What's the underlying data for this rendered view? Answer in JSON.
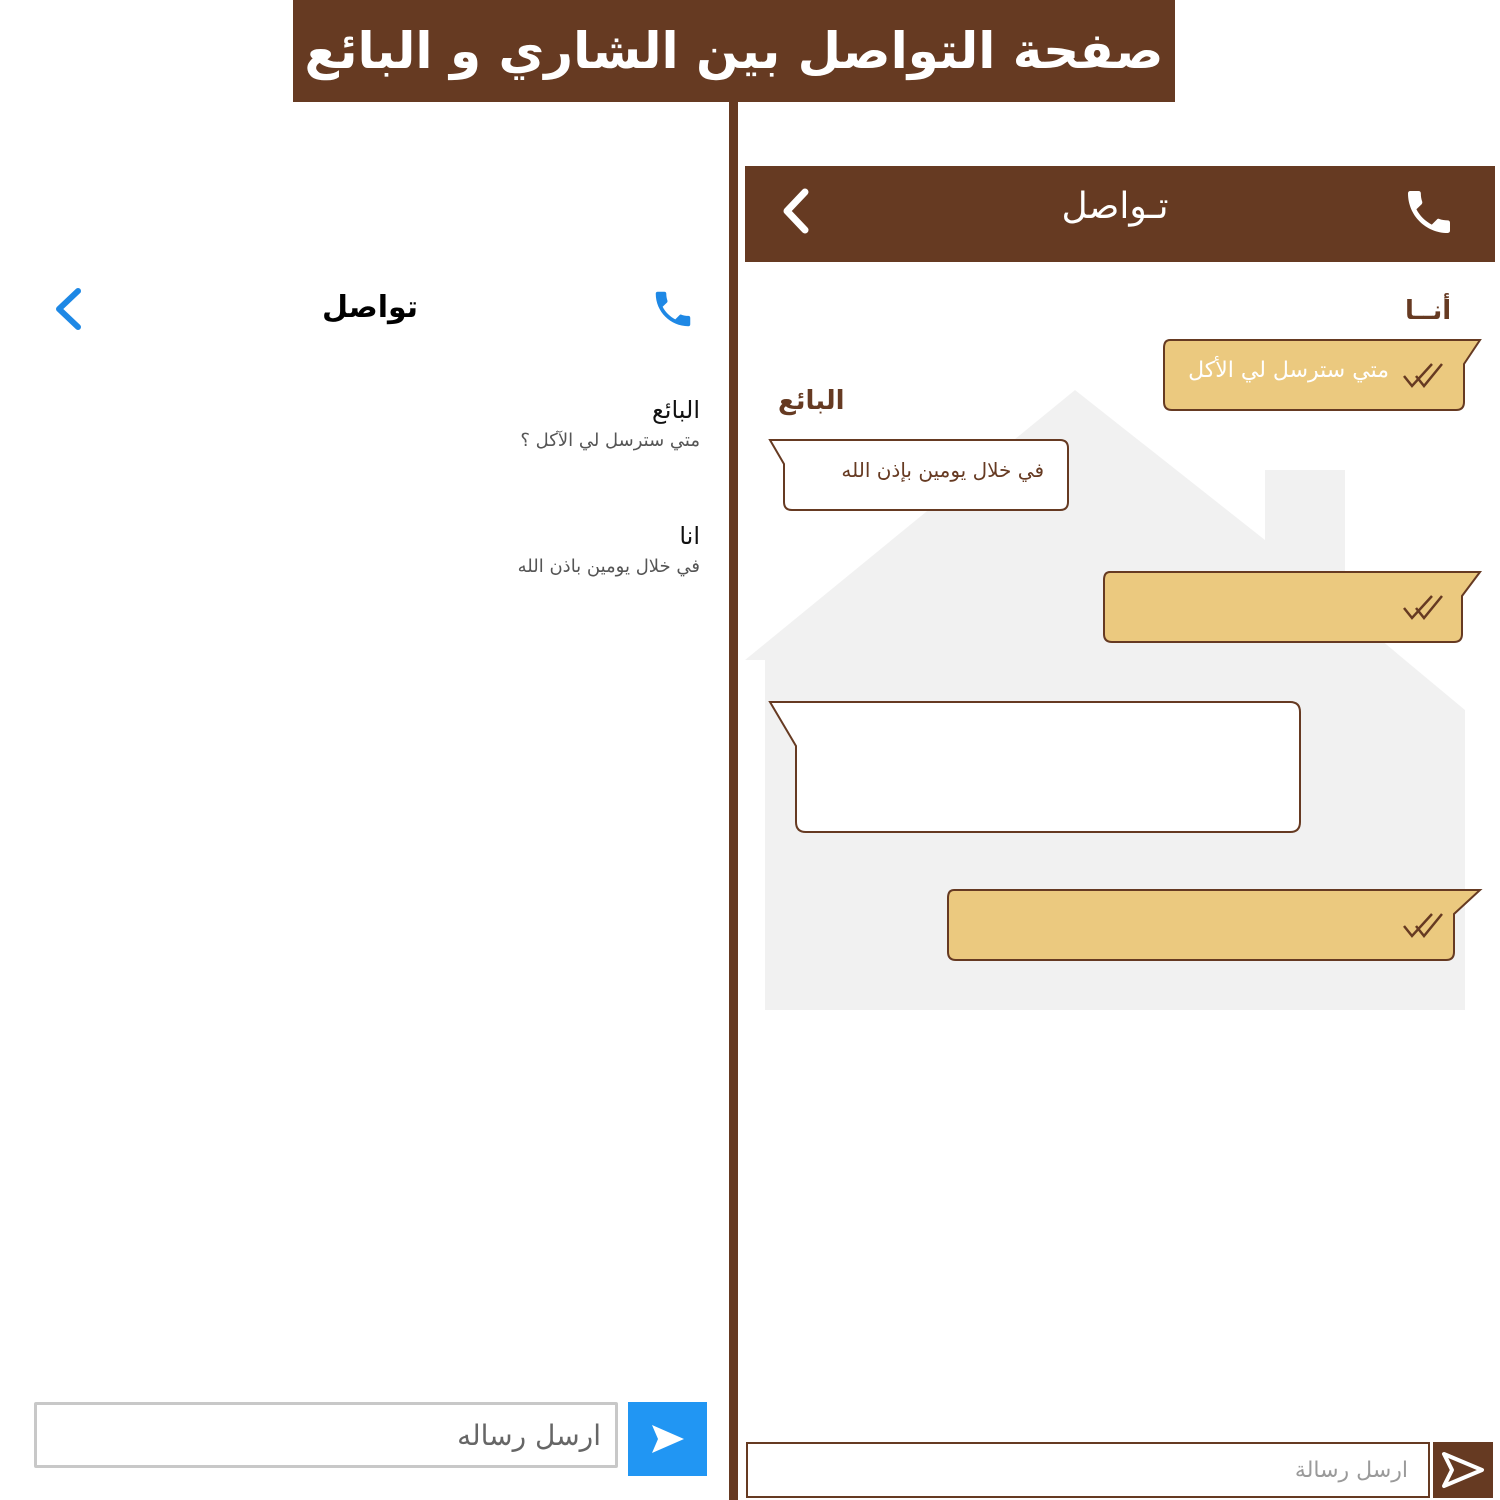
{
  "banner": {
    "title": "صفحة التواصل بين الشاري و البائع"
  },
  "old_screen": {
    "title": "تواصل",
    "icons": {
      "back": "chevron-left-icon",
      "call": "phone-icon"
    },
    "messages": [
      {
        "sender": "البائع",
        "text": "متي سترسل لي الآكل ؟"
      },
      {
        "sender": "انا",
        "text": "في خلال يومين باذن الله"
      }
    ],
    "input_placeholder": "ارسل رساله",
    "send_icon": "send-icon",
    "accent_color": "#2196f3"
  },
  "new_screen": {
    "title": "تـواصل",
    "icons": {
      "back": "chevron-left-icon",
      "call": "phone-icon",
      "read": "double-check-icon"
    },
    "me_label": "أنــا",
    "seller_label": "البائع",
    "messages": [
      {
        "from": "me",
        "text": "متي سترسل لي الأكل"
      },
      {
        "from": "seller",
        "text": "في خلال يومين بإذن الله"
      },
      {
        "from": "me",
        "text": ""
      },
      {
        "from": "seller",
        "text": ""
      },
      {
        "from": "me",
        "text": ""
      }
    ],
    "input_placeholder": "ارسل رسالة",
    "send_icon": "send-icon",
    "brand_color": "#663a22",
    "bubble_me_color": "#ebc97f",
    "bubble_seller_color": "#ffffff"
  }
}
